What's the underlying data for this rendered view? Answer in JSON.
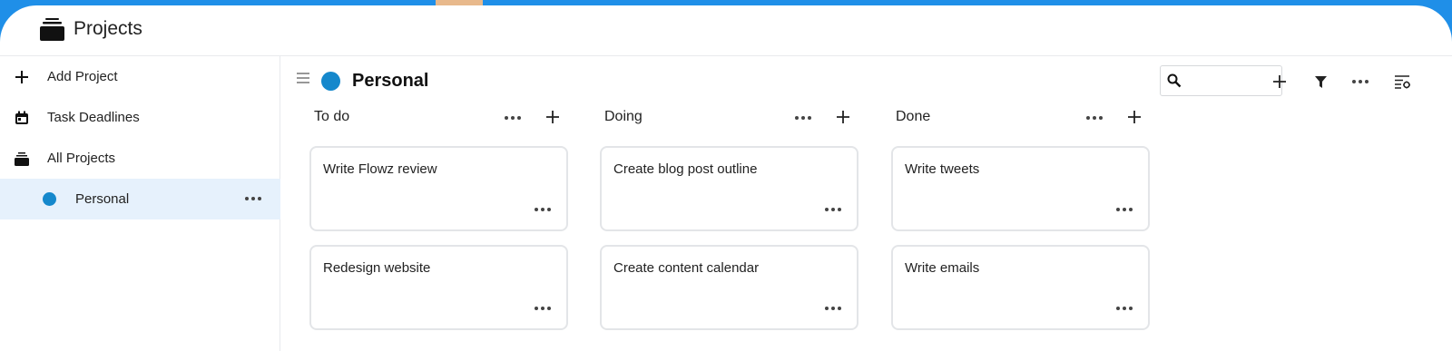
{
  "app": {
    "title": "Projects",
    "accent_color": "#1f8fe8",
    "project_color": "#1588cc"
  },
  "sidebar": {
    "items": [
      {
        "label": "Add Project",
        "icon": "plus-icon"
      },
      {
        "label": "Task Deadlines",
        "icon": "calendar-icon"
      },
      {
        "label": "All Projects",
        "icon": "stack-icon"
      },
      {
        "label": "Personal",
        "icon": "circle-icon",
        "active": true
      }
    ]
  },
  "project": {
    "title": "Personal"
  },
  "search": {
    "value": "",
    "placeholder": ""
  },
  "toolbar": {
    "icons": [
      "search-icon",
      "plus-icon",
      "filter-icon",
      "more-icon",
      "view-options-icon"
    ]
  },
  "columns": [
    {
      "title": "To do",
      "cards": [
        "Write Flowz review",
        "Redesign website"
      ]
    },
    {
      "title": "Doing",
      "cards": [
        "Create blog post outline",
        "Create content calendar"
      ]
    },
    {
      "title": "Done",
      "cards": [
        "Write tweets",
        "Write emails"
      ]
    }
  ]
}
